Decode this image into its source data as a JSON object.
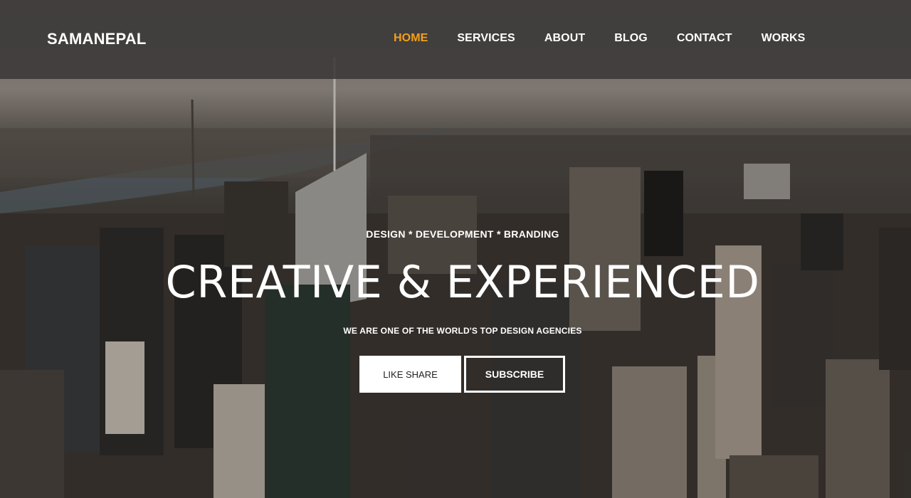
{
  "header": {
    "logo": "SAMANEPAL",
    "nav": [
      {
        "label": "HOME",
        "active": true
      },
      {
        "label": "SERVICES",
        "active": false
      },
      {
        "label": "ABOUT",
        "active": false
      },
      {
        "label": "BLOG",
        "active": false
      },
      {
        "label": "CONTACT",
        "active": false
      },
      {
        "label": "WORKS",
        "active": false
      }
    ]
  },
  "hero": {
    "tagline": "DESIGN * DEVELOPMENT * BRANDING",
    "headline": "CREATIVE & EXPERIENCED",
    "subline": "WE ARE ONE OF THE WORLD'S TOP DESIGN AGENCIES",
    "buttons": {
      "like_share": "LIKE SHARE",
      "subscribe": "SUBSCRIBE"
    }
  },
  "colors": {
    "accent": "#f5a016",
    "header_bg": "#3a3838",
    "text": "#ffffff"
  }
}
